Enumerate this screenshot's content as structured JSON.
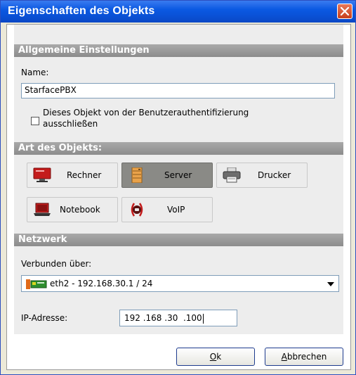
{
  "window": {
    "title": "Eigenschaften des Objekts"
  },
  "general": {
    "header": "Allgemeine Einstellungen",
    "name_label": "Name:",
    "name_value": "StarfacePBX",
    "exclude_checkbox_line1": "Dieses Objekt von der Benutzerauthentifizierung",
    "exclude_checkbox_line2": "ausschließen",
    "exclude_checked": false
  },
  "object_type": {
    "header": "Art des Objekts:",
    "options": [
      {
        "label": "Rechner",
        "icon": "computer-icon",
        "selected": false
      },
      {
        "label": "Server",
        "icon": "server-icon",
        "selected": true
      },
      {
        "label": "Drucker",
        "icon": "printer-icon",
        "selected": false
      },
      {
        "label": "Notebook",
        "icon": "notebook-icon",
        "selected": false
      },
      {
        "label": "VoIP",
        "icon": "voip-phone-icon",
        "selected": false
      }
    ]
  },
  "network": {
    "header": "Netzwerk",
    "connected_via_label": "Verbunden über:",
    "connected_via_value": "eth2 - 192.168.30.1 / 24",
    "ip_label": "IP-Adresse:",
    "ip_value": "192 .168 .30  .100"
  },
  "buttons": {
    "ok_prefix": "",
    "ok_underlined": "O",
    "ok_rest": "k",
    "cancel_underlined": "A",
    "cancel_rest": "bbrechen"
  }
}
